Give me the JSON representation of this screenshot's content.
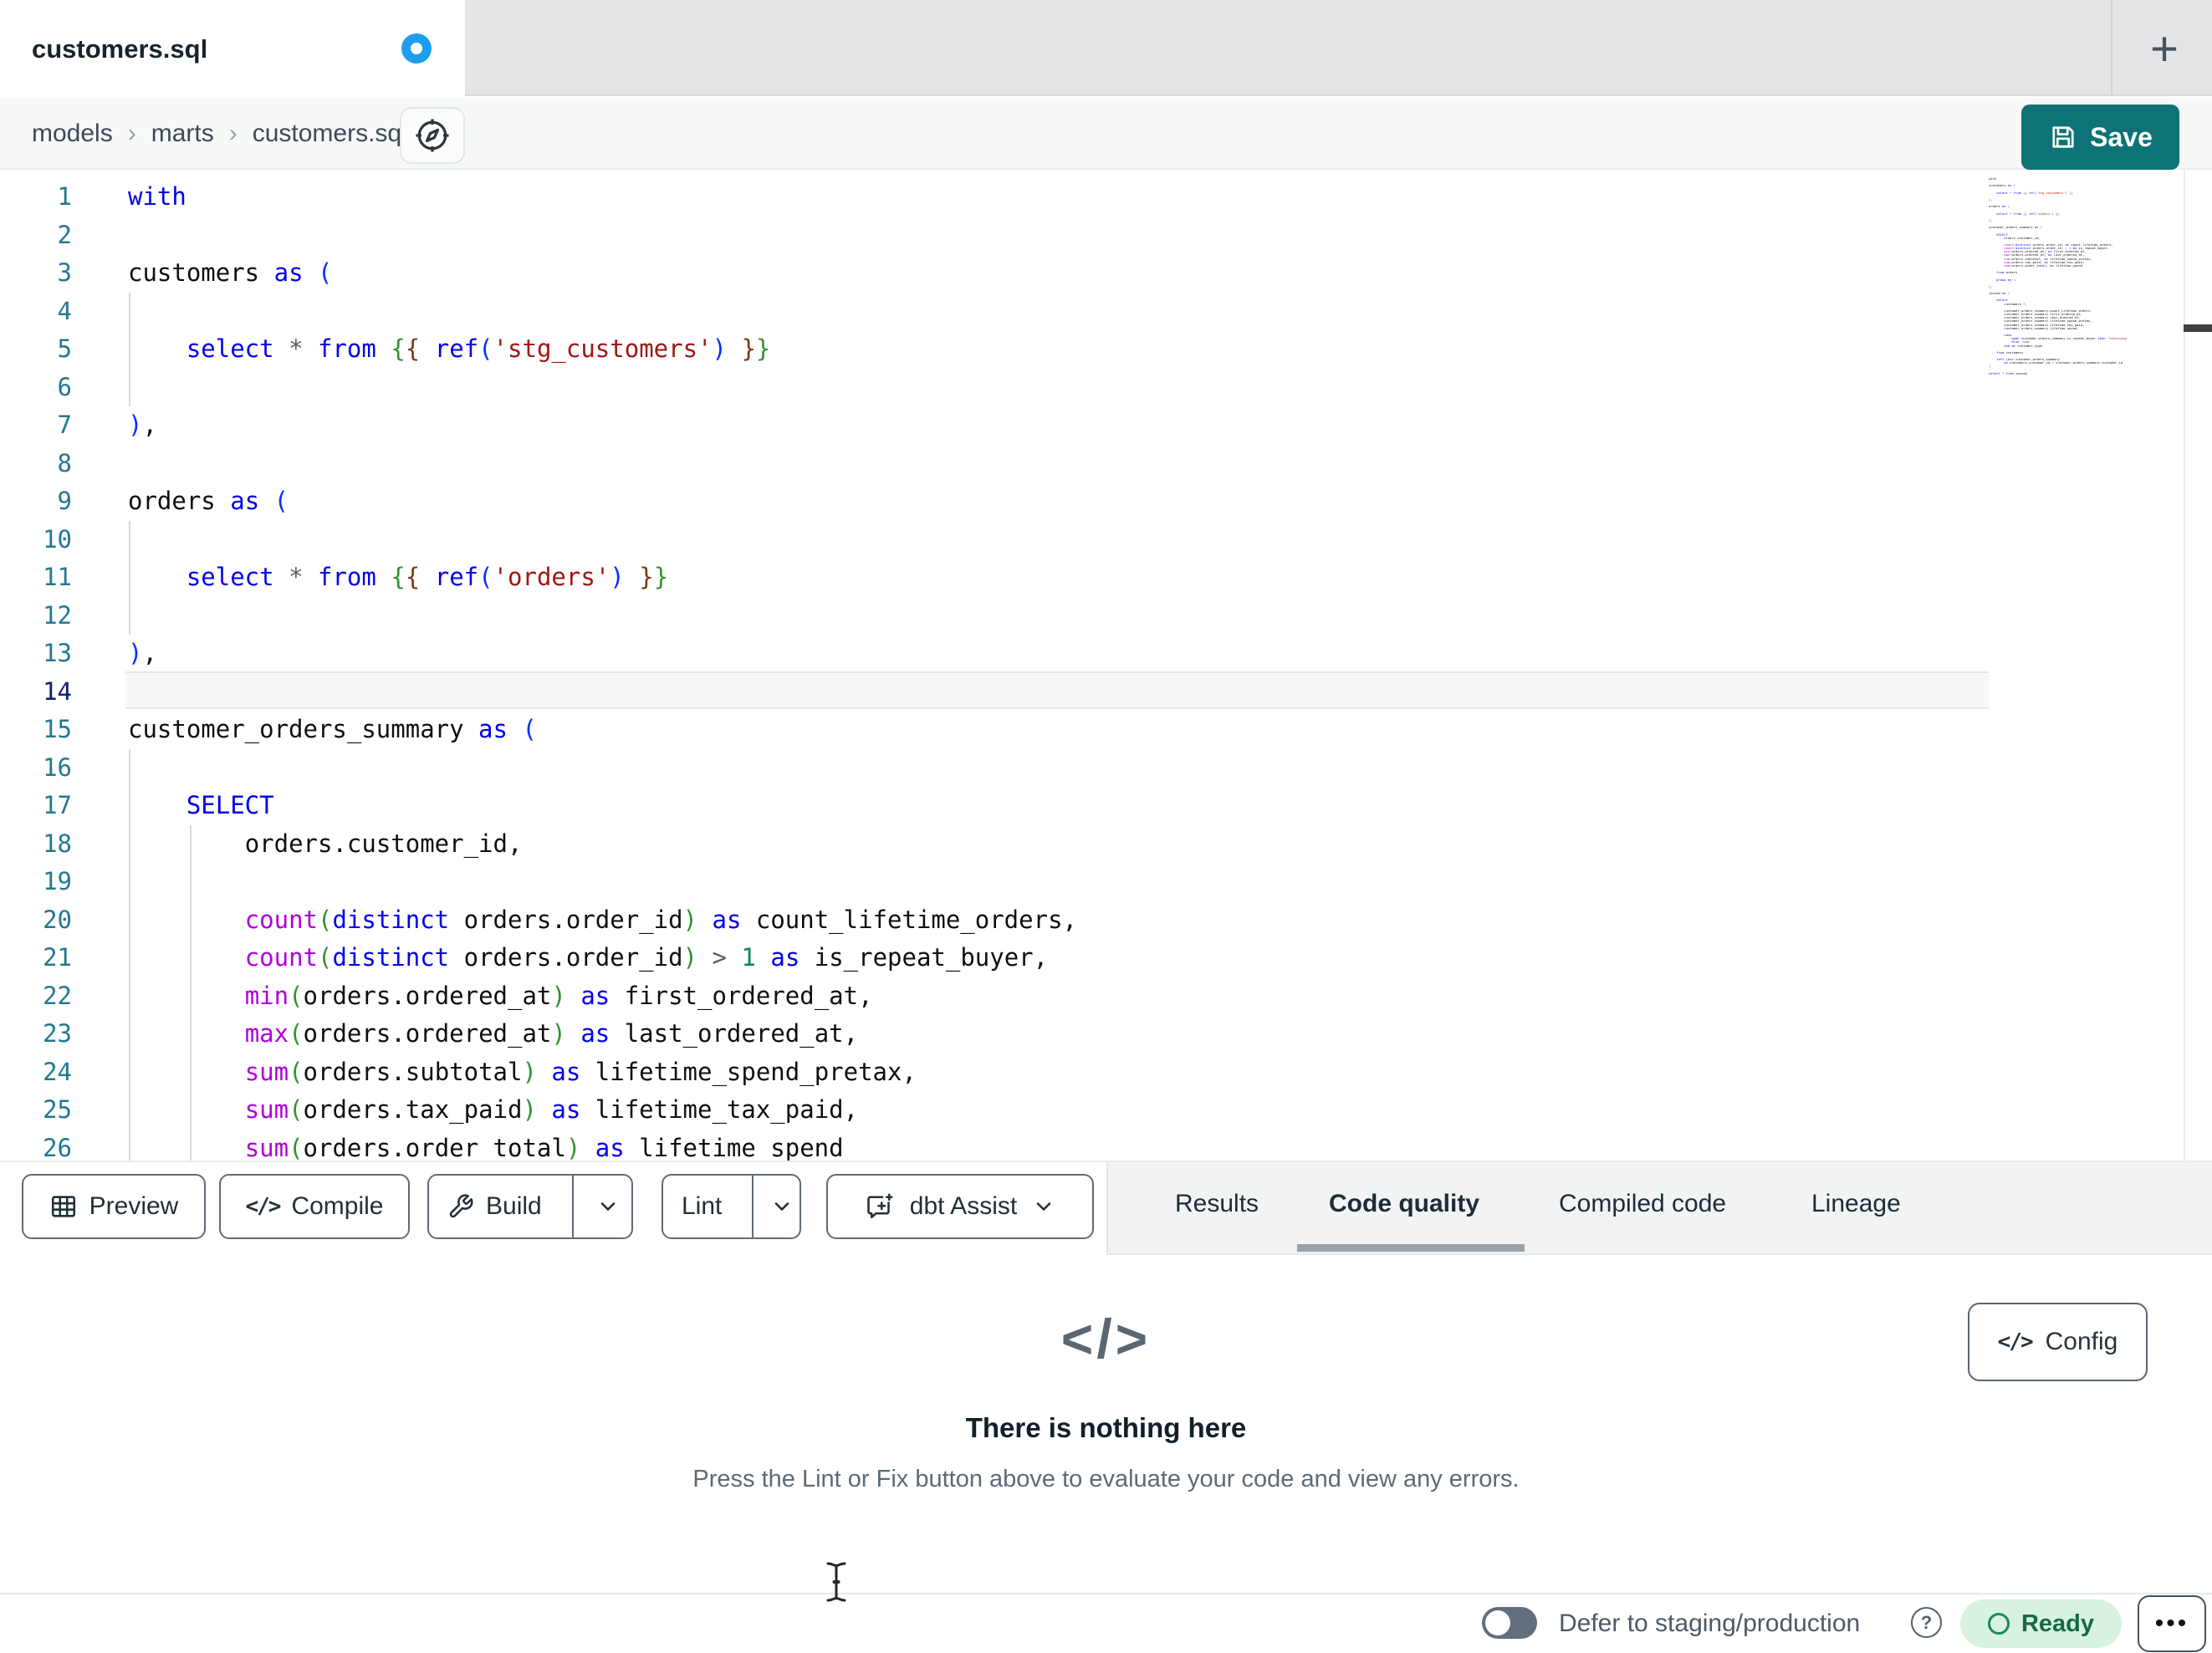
{
  "window": {
    "tab_title": "customers.sql",
    "new_tab_label": "+"
  },
  "breadcrumb": {
    "items": [
      "models",
      "marts",
      "customers.sql"
    ],
    "separator": "›"
  },
  "actions": {
    "save_label": "Save"
  },
  "editor": {
    "active_line": 14,
    "lines": [
      "with",
      "",
      "customers as (",
      "",
      "    select * from {{ ref('stg_customers') }}",
      "",
      "),",
      "",
      "orders as (",
      "",
      "    select * from {{ ref('orders') }}",
      "",
      "),",
      "",
      "customer_orders_summary as (",
      "",
      "    SELECT",
      "        orders.customer_id,",
      "",
      "        count(distinct orders.order_id) as count_lifetime_orders,",
      "        count(distinct orders.order_id) > 1 as is_repeat_buyer,",
      "        min(orders.ordered_at) as first_ordered_at,",
      "        max(orders.ordered_at) as last_ordered_at,",
      "        sum(orders.subtotal) as lifetime_spend_pretax,",
      "        sum(orders.tax_paid) as lifetime_tax_paid,",
      "        sum(orders.order_total) as lifetime_spend"
    ],
    "minimap_lines": [
      "with",
      "",
      "customers as (",
      "",
      "    select * from {{ ref('stg_customers') }}",
      "",
      "),",
      "",
      "orders as (",
      "",
      "    select * from {{ ref('orders') }}",
      "",
      "),",
      "",
      "customer_orders_summary as (",
      "",
      "    SELECT",
      "        orders.customer_id,",
      "",
      "        count(distinct orders.order_id) as count_lifetime_orders,",
      "        count(distinct orders.order_id) > 1 as is_repeat_buyer,",
      "        min(orders.ordered_at) as first_ordered_at,",
      "        max(orders.ordered_at) as last_ordered_at,",
      "        sum(orders.subtotal) as lifetime_spend_pretax,",
      "        sum(orders.tax_paid) as lifetime_tax_paid,",
      "        sum(orders.order_total) as lifetime_spend",
      "",
      "    from orders",
      "",
      "    group by 1",
      "",
      "),",
      "",
      "joined as (",
      "",
      "    select",
      "        customers.*,",
      "",
      "        customer_orders_summary.count_lifetime_orders,",
      "        customer_orders_summary.first_ordered_at,",
      "        customer_orders_summary.last_ordered_at,",
      "        customer_orders_summary.lifetime_spend_pretax,",
      "        customer_orders_summary.lifetime_tax_paid,",
      "        customer_orders_summary.lifetime_spend,",
      "",
      "        case",
      "            when customer_orders_summary.is_repeat_buyer then 'returning'",
      "            else 'new'",
      "        end as customer_type",
      "",
      "    from customers",
      "",
      "    left join customer_orders_summary",
      "        on customers.customer_id = customer_orders_summary.customer_id",
      ")",
      "",
      "select * from joined"
    ],
    "colors": {
      "keyword": "#0000ee",
      "function": "#af00db",
      "string": "#a31515",
      "number": "#098658",
      "operator": "#5f5f5f",
      "identifier": "#0f0f0f",
      "bracket_levels": [
        "#0431fa",
        "#319331",
        "#7b3814"
      ],
      "line_number": "#237893",
      "active_line_number": "#0b216f"
    }
  },
  "toolbar": {
    "preview_label": "Preview",
    "compile_label": "Compile",
    "build_label": "Build",
    "lint_label": "Lint",
    "dbt_assist_label": "dbt Assist",
    "compile_glyph": "</>"
  },
  "result_tabs": [
    {
      "label": "Results",
      "active": false
    },
    {
      "label": "Code quality",
      "active": true
    },
    {
      "label": "Compiled code",
      "active": false
    },
    {
      "label": "Lineage",
      "active": false
    }
  ],
  "panel": {
    "empty_icon": "</>",
    "empty_title": "There is nothing here",
    "empty_subtitle": "Press the Lint or Fix button above to evaluate your code and view any errors.",
    "config_label": "Config",
    "config_glyph": "</>"
  },
  "statusbar": {
    "defer_label": "Defer to staging/production",
    "help_glyph": "?",
    "ready_label": "Ready",
    "more_glyph": "•••",
    "ready_bg": "#d7f3e0",
    "ready_text": "#176945"
  },
  "brand": {
    "save_button_color": "#0d7377",
    "dirty_dot_color": "#1f9ded"
  }
}
